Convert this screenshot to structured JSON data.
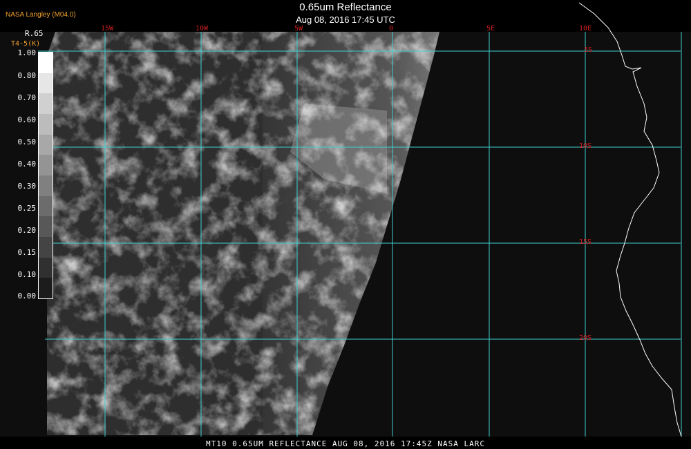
{
  "header": {
    "credit": "NASA Langley (M04.0)",
    "title": "0.65um Reflectance",
    "datetime": "Aug 08, 2016 17:45 UTC"
  },
  "legend": {
    "title": "R.65",
    "subtitle": "T4-5(K)",
    "ticks": [
      "1.00",
      "0.80",
      "0.70",
      "0.60",
      "0.50",
      "0.40",
      "0.30",
      "0.25",
      "0.20",
      "0.15",
      "0.10",
      "0.00"
    ]
  },
  "map": {
    "lon_labels": [
      "15W",
      "10W",
      "5W",
      "0",
      "5E",
      "10E"
    ],
    "lat_labels": [
      "5S",
      "10S",
      "15S",
      "20S"
    ],
    "colors": {
      "grid": "#40d0d0",
      "labels": "#d02020",
      "coast": "#ffffff"
    }
  },
  "footer": {
    "caption": "MT10  0.65UM REFLECTANCE   AUG 08, 2016 17:45Z   NASA LARC"
  }
}
